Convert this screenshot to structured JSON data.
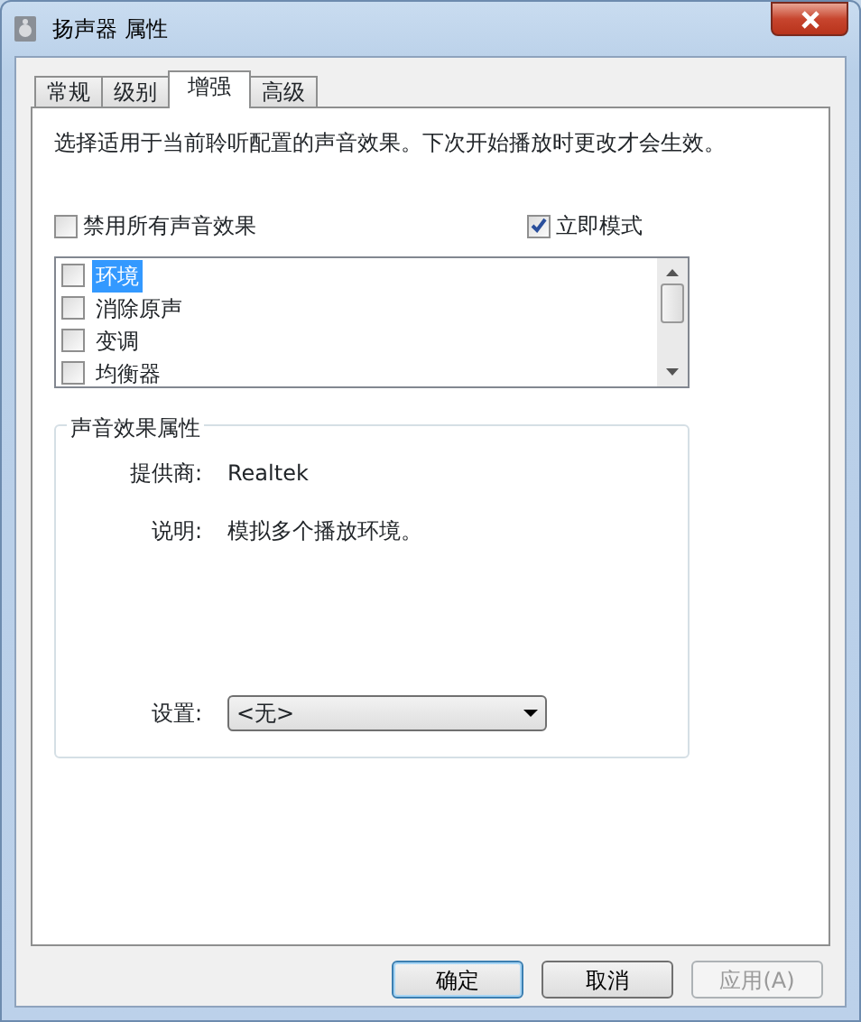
{
  "window": {
    "title": "扬声器 属性"
  },
  "tabs": [
    {
      "label": "常规",
      "selected": false
    },
    {
      "label": "级别",
      "selected": false
    },
    {
      "label": "增强",
      "selected": true
    },
    {
      "label": "高级",
      "selected": false
    }
  ],
  "description": "选择适用于当前聆听配置的声音效果。下次开始播放时更改才会生效。",
  "disable_all": {
    "label": "禁用所有声音效果",
    "checked": false
  },
  "immediate_mode": {
    "label": "立即模式",
    "checked": true
  },
  "effects": [
    {
      "label": "环境",
      "checked": false,
      "selected": true
    },
    {
      "label": "消除原声",
      "checked": false,
      "selected": false
    },
    {
      "label": "变调",
      "checked": false,
      "selected": false
    },
    {
      "label": "均衡器",
      "checked": false,
      "selected": false
    }
  ],
  "properties": {
    "title": "声音效果属性",
    "provider_label": "提供商:",
    "provider": "Realtek",
    "description_label": "说明:",
    "description": "模拟多个播放环境。",
    "setting_label": "设置:",
    "setting_value": "<无>"
  },
  "buttons": [
    {
      "label": "确定",
      "disabled": false,
      "default": true
    },
    {
      "label": "取消",
      "disabled": false,
      "default": false
    },
    {
      "label": "应用(A)",
      "disabled": true,
      "default": false
    }
  ]
}
